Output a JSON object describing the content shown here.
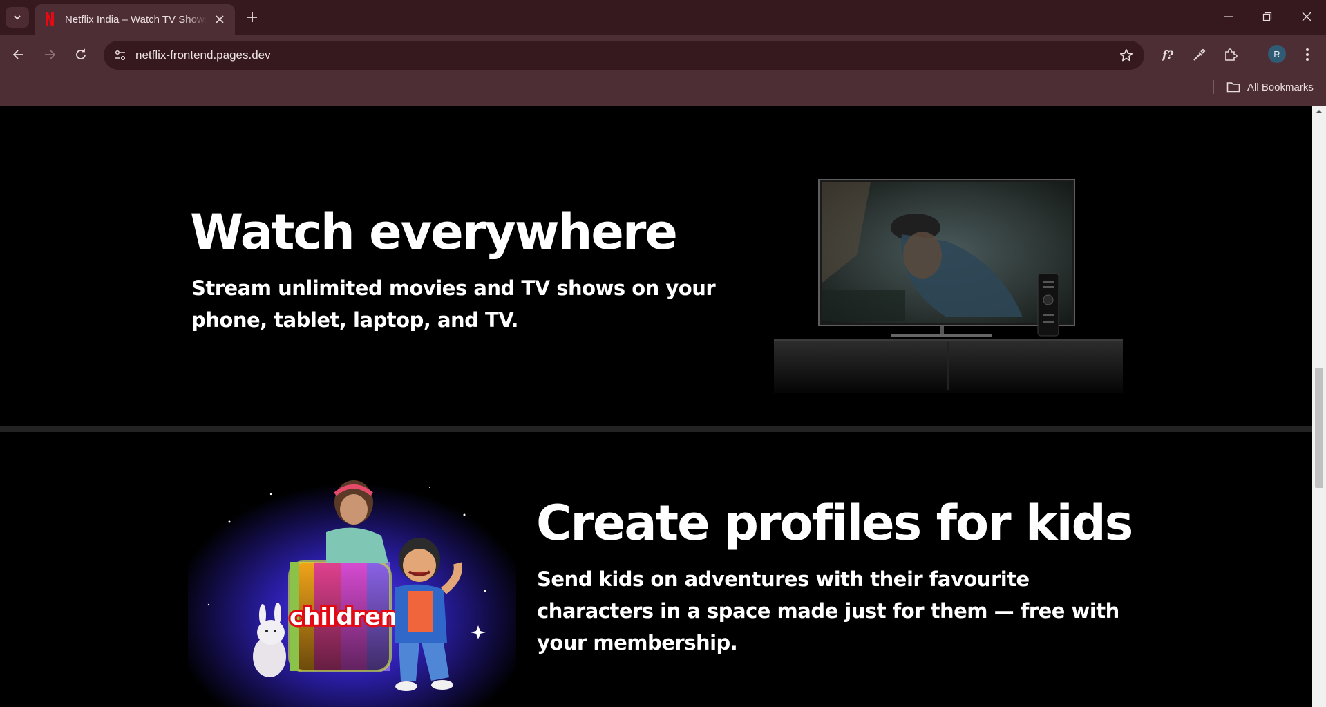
{
  "browser": {
    "tab_title": "Netflix India – Watch TV Shows Online",
    "url": "netflix-frontend.pages.dev",
    "bookmarks_label": "All Bookmarks",
    "avatar_letter": "R"
  },
  "features": [
    {
      "heading": "Watch everywhere",
      "text": "Stream unlimited movies and TV shows on your phone, tablet, laptop, and TV."
    },
    {
      "heading": "Create profiles for kids",
      "text": "Send kids on adventures with their favourite characters in a space made just for them — free with your membership.",
      "image_label": "children"
    }
  ],
  "colors": {
    "tabstrip": "#35191f",
    "toolbar": "#4e2e35",
    "page_bg": "#000000",
    "divider": "#232323",
    "netflix_red": "#e50914"
  }
}
